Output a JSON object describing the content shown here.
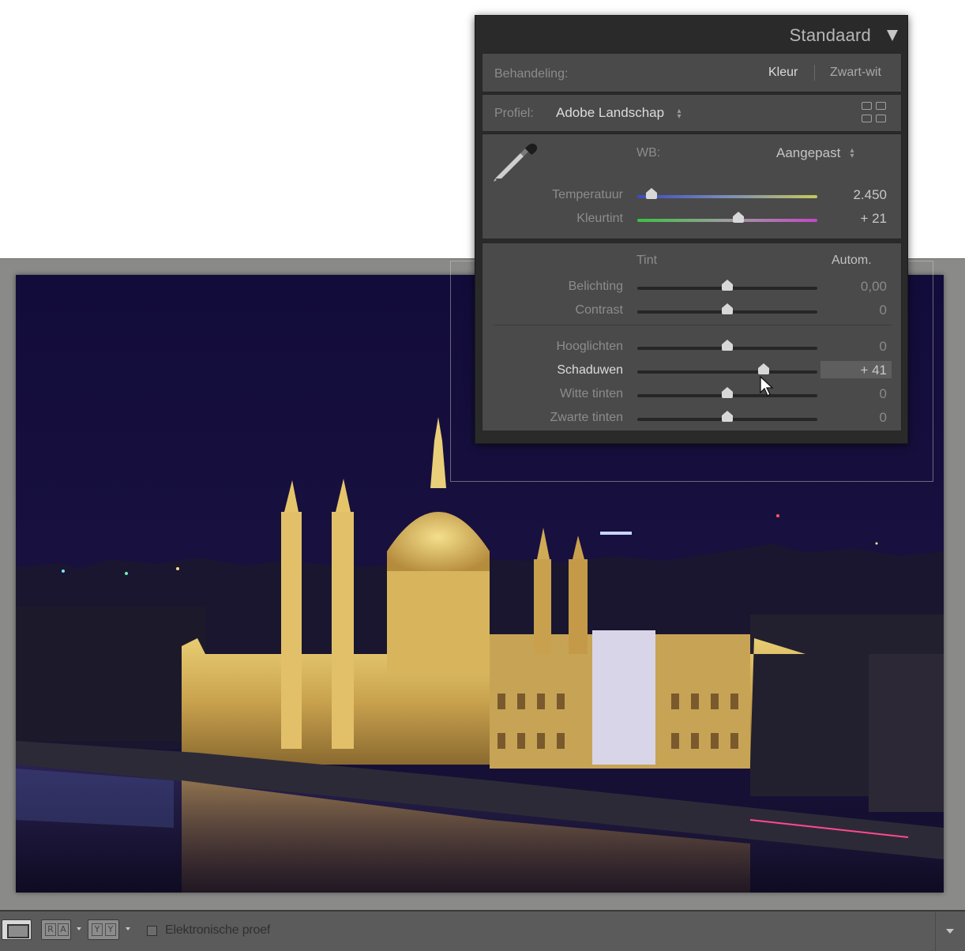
{
  "panel": {
    "title": "Standaard",
    "treatment": {
      "label": "Behandeling:",
      "option_color": "Kleur",
      "option_bw": "Zwart-wit"
    },
    "profile": {
      "label": "Profiel:",
      "value": "Adobe Landschap"
    },
    "wb": {
      "label": "WB:",
      "value": "Aangepast",
      "sliders": [
        {
          "label": "Temperatuur",
          "value": "2.450",
          "level": 0.08
        },
        {
          "label": "Kleurtint",
          "value": "+ 21",
          "level": 0.56
        }
      ]
    },
    "tone": {
      "label": "Tint",
      "auto_label": "Autom.",
      "sliders": [
        {
          "label": "Belichting",
          "value": "0,00",
          "level": 0.5
        },
        {
          "label": "Contrast",
          "value": "0",
          "level": 0.5
        },
        {
          "label": "Hooglichten",
          "value": "0",
          "level": 0.5
        },
        {
          "label": "Schaduwen",
          "value": "+ 41",
          "level": 0.7
        },
        {
          "label": "Witte tinten",
          "value": "0",
          "level": 0.5
        },
        {
          "label": "Zwarte tinten",
          "value": "0",
          "level": 0.5
        }
      ]
    }
  },
  "toolbar": {
    "before_after_letters": [
      "R",
      "A"
    ],
    "yy_letters": [
      "Y",
      "Y"
    ],
    "proof_label": "Elektronische proef"
  },
  "icons": {
    "panel_menu": "triangle-down-icon",
    "profile_browser": "grid-icon",
    "wb_selector": "eyedropper-icon",
    "cursor": "pointer-cursor-icon"
  },
  "colors": {
    "panel_bg": "#2a2a2a",
    "section_bg": "#4a4a4a",
    "loupe_bg": "#8a8a88",
    "toolbar_bg": "#5b5b5b",
    "night_sky": "#140f38"
  }
}
